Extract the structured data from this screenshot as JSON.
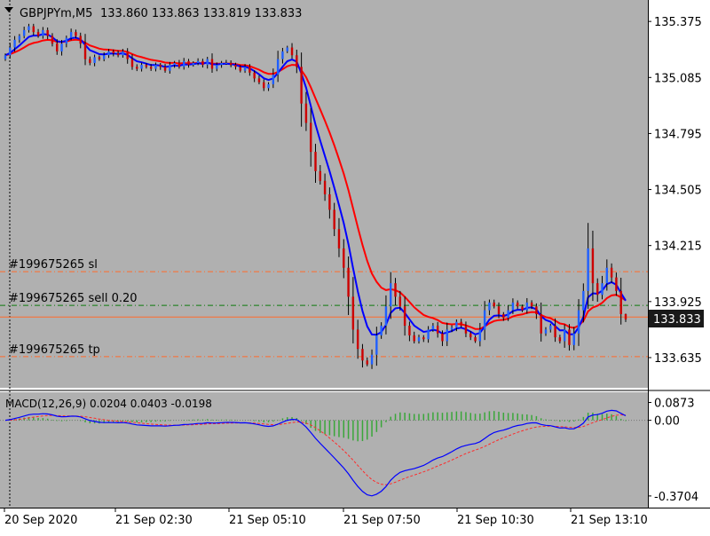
{
  "chart_header": {
    "symbol_timeframe": "GBPJPYm,M5",
    "ohlc": "133.860 133.863 133.819 133.833"
  },
  "colors": {
    "background": "#b0b0b0",
    "bull_candle": "#1f5fff",
    "bear_candle": "#cc0000",
    "ma_fast": "#0000ff",
    "ma_slow": "#ff0000",
    "order_level": "#ff6a2a",
    "entry_level": "#0d7a0d",
    "price_label_bg": "#1a1a1a",
    "macd_hist": "#3aa63a",
    "macd_line": "#0000ff",
    "macd_signal": "#ff2a2a"
  },
  "chart_data": [
    {
      "type": "candlestick",
      "title": "GBPJPYm,M5",
      "ylim": [
        133.52,
        135.44
      ],
      "y_ticks": [
        "135.375",
        "135.085",
        "134.795",
        "134.505",
        "134.215",
        "133.925",
        "133.635"
      ],
      "x_ticks": [
        "20 Sep 2020",
        "21 Sep 02:30",
        "21 Sep 05:10",
        "21 Sep 07:50",
        "21 Sep 10:30",
        "21 Sep 13:10"
      ],
      "current_price": "133.833",
      "last_bar": {
        "open": 133.86,
        "high": 133.863,
        "low": 133.819,
        "close": 133.833
      },
      "order_lines": [
        {
          "label": "#199675265 sl",
          "price": 134.08,
          "style": "dashdot",
          "color_key": "order_level"
        },
        {
          "label": "#199675265 sell 0.20",
          "price": 133.905,
          "style": "dashdot",
          "color_key": "entry_level"
        },
        {
          "label": "#199675265 tp",
          "price": 133.64,
          "style": "dashdot",
          "color_key": "order_level"
        },
        {
          "label": "",
          "price": 133.845,
          "style": "solid",
          "color_key": "order_level"
        }
      ],
      "series": [
        {
          "kind": "candles",
          "close": [
            135.2,
            135.24,
            135.28,
            135.3,
            135.33,
            135.35,
            135.32,
            135.3,
            135.33,
            135.3,
            135.26,
            135.22,
            135.26,
            135.29,
            135.32,
            135.3,
            135.26,
            135.18,
            135.16,
            135.19,
            135.18,
            135.2,
            135.22,
            135.21,
            135.2,
            135.22,
            135.18,
            135.14,
            135.13,
            135.15,
            135.14,
            135.13,
            135.15,
            135.14,
            135.12,
            135.15,
            135.16,
            135.14,
            135.17,
            135.15,
            135.16,
            135.17,
            135.15,
            135.18,
            135.13,
            135.15,
            135.16,
            135.16,
            135.15,
            135.14,
            135.12,
            135.14,
            135.11,
            135.08,
            135.06,
            135.03,
            135.05,
            135.1,
            135.18,
            135.22,
            135.24,
            135.2,
            135.14,
            134.95,
            134.85,
            134.7,
            134.6,
            134.55,
            134.48,
            134.4,
            134.3,
            134.2,
            134.1,
            133.95,
            133.78,
            133.68,
            133.62,
            133.6,
            133.65,
            133.75,
            133.8,
            133.9,
            134.02,
            133.95,
            133.9,
            133.8,
            133.75,
            133.72,
            133.74,
            133.73,
            133.78,
            133.8,
            133.76,
            133.72,
            133.78,
            133.79,
            133.82,
            133.8,
            133.76,
            133.74,
            133.72,
            133.78,
            133.88,
            133.92,
            133.9,
            133.86,
            133.84,
            133.88,
            133.92,
            133.9,
            133.88,
            133.92,
            133.9,
            133.86,
            133.76,
            133.78,
            133.8,
            133.74,
            133.72,
            133.78,
            133.7,
            133.76,
            133.88,
            133.98,
            134.2,
            134.02,
            133.96,
            134.02,
            134.1,
            134.05,
            133.98,
            133.86,
            133.833
          ]
        },
        {
          "name": "MA (blue)",
          "color_key": "ma_fast"
        },
        {
          "name": "MA (red)",
          "color_key": "ma_slow"
        }
      ]
    },
    {
      "type": "macd",
      "label": "MACD(12,26,9) 0.0204 0.0403 -0.0198",
      "params": [
        12,
        26,
        9
      ],
      "values": {
        "macd": 0.0204,
        "signal": 0.0403,
        "diff": -0.0198
      },
      "ylim": [
        -0.41,
        0.12
      ],
      "y_ticks": [
        "0.0873",
        "0.00",
        "-0.3704"
      ]
    }
  ]
}
